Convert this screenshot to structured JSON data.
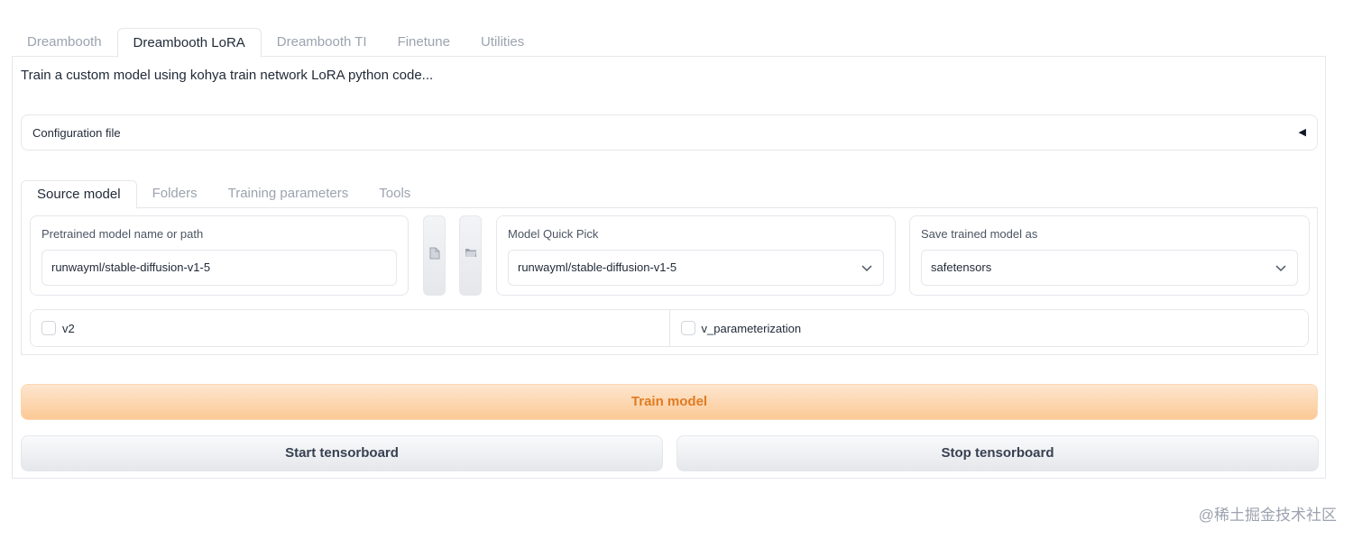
{
  "top_tabs": [
    "Dreambooth",
    "Dreambooth LoRA",
    "Dreambooth TI",
    "Finetune",
    "Utilities"
  ],
  "active_top_tab": 1,
  "description": "Train a custom model using kohya train network LoRA python code...",
  "config_accordion": {
    "label": "Configuration file",
    "icon": "◀"
  },
  "inner_tabs": [
    "Source model",
    "Folders",
    "Training parameters",
    "Tools"
  ],
  "active_inner_tab": 0,
  "pretrained": {
    "label": "Pretrained model name or path",
    "value": "runwayml/stable-diffusion-v1-5"
  },
  "quick_pick": {
    "label": "Model Quick Pick",
    "value": "runwayml/stable-diffusion-v1-5"
  },
  "save_as": {
    "label": "Save trained model as",
    "value": "safetensors"
  },
  "checkboxes": {
    "v2": "v2",
    "v_param": "v_parameterization"
  },
  "buttons": {
    "train": "Train model",
    "start_tb": "Start tensorboard",
    "stop_tb": "Stop tensorboard"
  },
  "watermark": "@稀土掘金技术社区",
  "colors": {
    "accent": "#e07b22",
    "primary_bg": "#fbc995"
  }
}
